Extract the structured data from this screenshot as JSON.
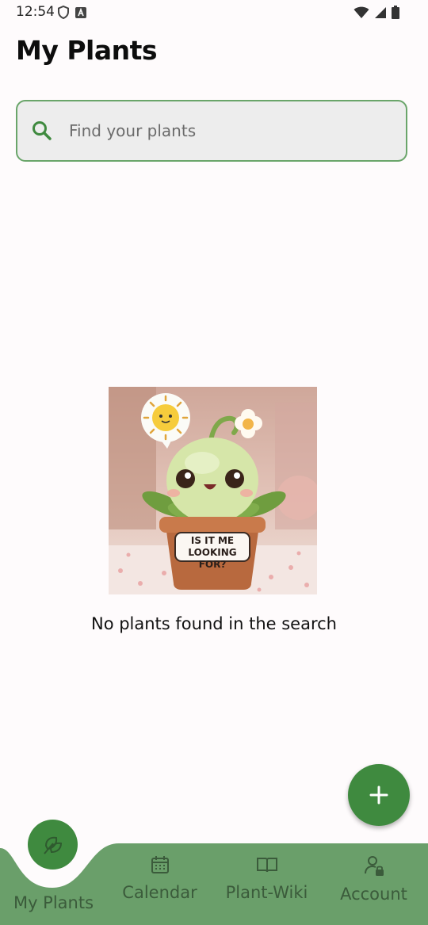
{
  "status_bar": {
    "time": "12:54",
    "icons_left": [
      "shield-icon",
      "a-icon"
    ],
    "icons_right": [
      "wifi-icon",
      "signal-icon",
      "battery-icon"
    ]
  },
  "header": {
    "title": "My Plants"
  },
  "search": {
    "placeholder": "Find your plants",
    "value": ""
  },
  "empty_state": {
    "image_text": "IS IT ME LOOKING FOR?",
    "message": "No plants found in the search"
  },
  "fab": {
    "icon": "plus-icon"
  },
  "bottom_nav": {
    "active_index": 0,
    "items": [
      {
        "label": "My Plants",
        "icon": "leaves-icon"
      },
      {
        "label": "Calendar",
        "icon": "calendar-icon"
      },
      {
        "label": "Plant-Wiki",
        "icon": "book-icon"
      },
      {
        "label": "Account",
        "icon": "account-icon"
      }
    ]
  },
  "colors": {
    "accent": "#3f8a3f",
    "nav_background": "#6a9f6a",
    "search_border": "#6aa56a",
    "search_background": "#ededed",
    "page_background": "#fefbfc"
  }
}
